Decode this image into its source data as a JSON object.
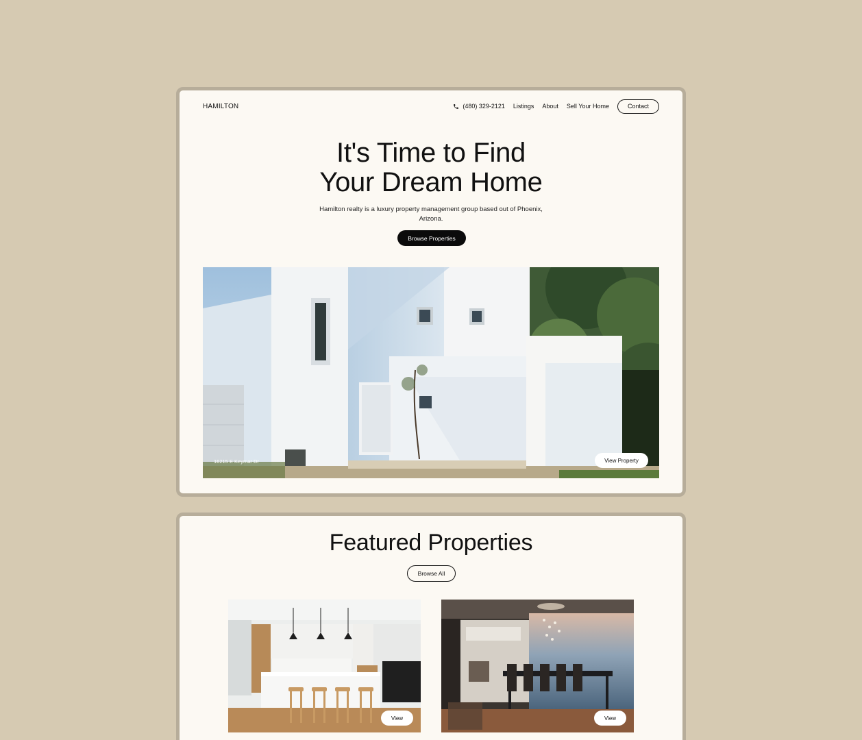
{
  "nav": {
    "logo": "HAMILTON",
    "phone": "(480) 329-2121",
    "links": [
      "Listings",
      "About",
      "Sell Your Home"
    ],
    "contact_label": "Contact"
  },
  "hero": {
    "title_line1": "It's Time to Find",
    "title_line2": "Your Dream Home",
    "subtitle": "Hamilton realty is a luxury property management group based out of Phoenix, Arizona.",
    "cta_label": "Browse Properties",
    "address": "16215 E Keymar Dr",
    "view_property_label": "View Property"
  },
  "featured": {
    "title": "Featured Properties",
    "browse_all_label": "Browse All",
    "properties": [
      {
        "view_label": "View"
      },
      {
        "view_label": "View"
      }
    ]
  },
  "colors": {
    "page_bg": "#d6cab2",
    "card_bg": "#fcf9f3",
    "card_border": "#b7ad9a",
    "primary_button": "#0b0b0b"
  }
}
